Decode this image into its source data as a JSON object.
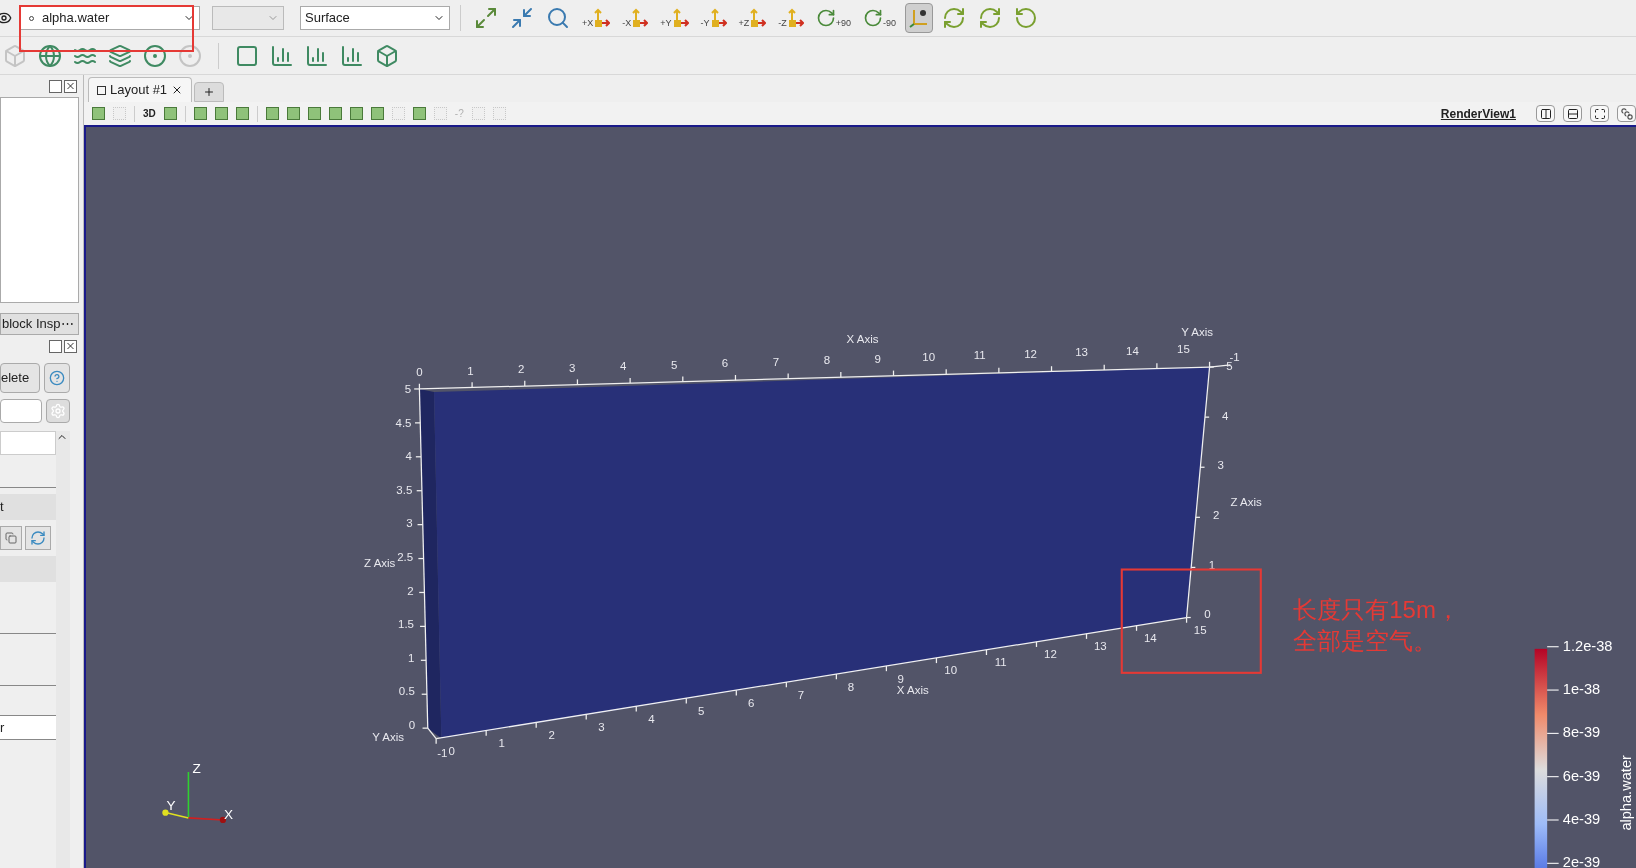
{
  "toolbar": {
    "source_combo": {
      "value": "alpha.water"
    },
    "representation_combo": {
      "value": "Surface"
    },
    "camera_buttons": [
      {
        "kind": "reset",
        "selected": false
      },
      {
        "kind": "zoom-data",
        "selected": false
      },
      {
        "kind": "zoom-box",
        "selected": false
      },
      {
        "kind": "view-axis",
        "label": "+X",
        "selected": false
      },
      {
        "kind": "view-axis",
        "label": "-X",
        "selected": false
      },
      {
        "kind": "view-axis",
        "label": "+Y",
        "selected": false
      },
      {
        "kind": "view-axis",
        "label": "-Y",
        "selected": false
      },
      {
        "kind": "view-axis",
        "label": "+Z",
        "selected": false
      },
      {
        "kind": "view-axis",
        "label": "-Z",
        "selected": false
      },
      {
        "kind": "rotate",
        "label": "+90",
        "selected": false
      },
      {
        "kind": "rotate",
        "label": "-90",
        "selected": false
      },
      {
        "kind": "axes-toggle",
        "selected": true
      },
      {
        "kind": "center",
        "selected": false
      },
      {
        "kind": "center",
        "selected": false
      },
      {
        "kind": "pick",
        "selected": false
      }
    ],
    "filter_buttons": [
      {
        "kind": "cube",
        "disabled": true
      },
      {
        "kind": "sphere",
        "disabled": false
      },
      {
        "kind": "waves",
        "disabled": false
      },
      {
        "kind": "slice",
        "disabled": false
      },
      {
        "kind": "circles",
        "disabled": false
      },
      {
        "kind": "circles",
        "disabled": true
      },
      {
        "kind": "divider"
      },
      {
        "kind": "square",
        "disabled": false
      },
      {
        "kind": "chart",
        "disabled": false
      },
      {
        "kind": "chart",
        "disabled": false
      },
      {
        "kind": "chart",
        "disabled": false
      },
      {
        "kind": "cube",
        "disabled": false
      }
    ]
  },
  "left_panel": {
    "tab": "block Insp⋯",
    "delete_button": "elete",
    "rows": [
      "t",
      "r"
    ]
  },
  "tabs": [
    {
      "label": "Layout #1",
      "selected": true
    }
  ],
  "view_toolbar": {
    "items": [
      {
        "kind": "tool",
        "disabled": false
      },
      {
        "kind": "tool",
        "disabled": true
      },
      {
        "kind": "divider"
      },
      {
        "kind": "text",
        "label": "3D",
        "disabled": false
      },
      {
        "kind": "tool",
        "disabled": false
      },
      {
        "kind": "divider"
      },
      {
        "kind": "tool",
        "disabled": false
      },
      {
        "kind": "tool",
        "disabled": false
      },
      {
        "kind": "tool",
        "disabled": false
      },
      {
        "kind": "divider"
      },
      {
        "kind": "tool",
        "disabled": false
      },
      {
        "kind": "tool",
        "disabled": false
      },
      {
        "kind": "tool",
        "disabled": false
      },
      {
        "kind": "tool",
        "disabled": false
      },
      {
        "kind": "tool",
        "disabled": false
      },
      {
        "kind": "tool",
        "disabled": false
      },
      {
        "kind": "tool",
        "disabled": true
      },
      {
        "kind": "tool",
        "disabled": false
      },
      {
        "kind": "tool",
        "disabled": true
      },
      {
        "kind": "text",
        "label": "-?",
        "disabled": true
      },
      {
        "kind": "tool",
        "disabled": true
      },
      {
        "kind": "tool",
        "disabled": true
      }
    ],
    "view_name": "RenderView1"
  },
  "render": {
    "axes": [
      {
        "title": "X Axis",
        "ticks": [
          "0",
          "1",
          "2",
          "3",
          "4",
          "5",
          "6",
          "7",
          "8",
          "9",
          "10",
          "11",
          "12",
          "13",
          "14",
          "15"
        ]
      },
      {
        "title": "X Axis",
        "ticks": [
          "0",
          "1",
          "2",
          "3",
          "4",
          "5",
          "6",
          "7",
          "8",
          "9",
          "10",
          "11",
          "12",
          "13",
          "14",
          "15"
        ]
      },
      {
        "title": "Z Axis",
        "ticks": [
          "5",
          "4.5",
          "4",
          "3.5",
          "3",
          "2.5",
          "2",
          "1.5",
          "1",
          "0.5",
          "0"
        ]
      },
      {
        "title": "Z Axis",
        "ticks": [
          "5",
          "4",
          "3",
          "2",
          "1",
          "0"
        ]
      },
      {
        "title": "Y Axis",
        "ticks": [
          "-1"
        ]
      },
      {
        "title": "Y Axis",
        "ticks": [
          "-1"
        ]
      }
    ],
    "orientation": {
      "x": "X",
      "y": "Y",
      "z": "Z"
    },
    "colorbar": {
      "title": "alpha.water",
      "ticks": [
        "1.2e-38",
        "1e-38",
        "8e-39",
        "6e-39",
        "4e-39",
        "2e-39"
      ]
    },
    "annotation": {
      "lines": [
        "长度只有15m，",
        "全部是空气。"
      ]
    }
  }
}
